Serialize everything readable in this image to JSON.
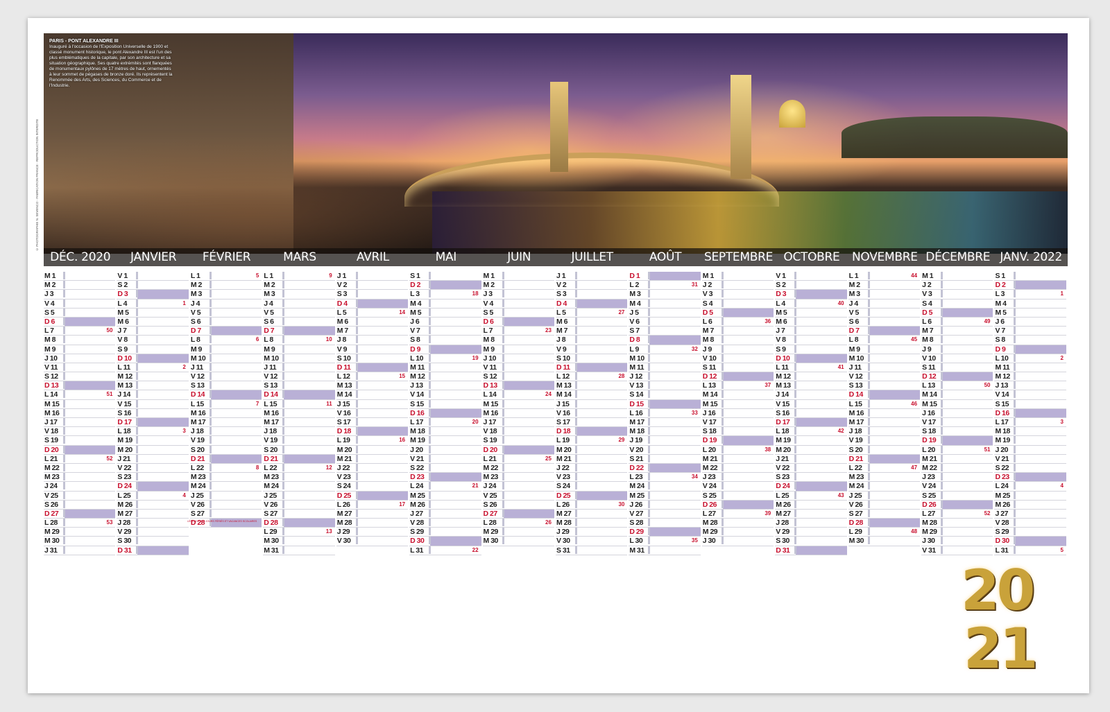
{
  "photo": {
    "caption_title": "PARIS - PONT ALEXANDRE III",
    "caption_text": "Inauguré à l'occasion de l'Exposition Universelle de 1900 et classé monument historique, le pont Alexandre III est l'un des plus emblématiques de la capitale, par son architecture et sa situation géographique. Ses quatre extrémités sont flanquées de monumentaux pylônes de 17 mètres de haut, ornementés à leur sommet de pégases de bronze doré. Ils représentent la Renommée des Arts, des Sciences, du Commerce et de l'Industrie.",
    "copyright": "© PHOTOGRAPHIE N. SEVENCO - FABRICATION FRANCE - REPRODUCTION INTERDITE"
  },
  "months": [
    "DÉC. 2020",
    "JANVIER",
    "FÉVRIER",
    "MARS",
    "AVRIL",
    "MAI",
    "JUIN",
    "JUILLET",
    "AOÛT",
    "SEPTEMBRE",
    "OCTOBRE",
    "NOVEMBRE",
    "DÉCEMBRE",
    "JANV. 2022"
  ],
  "legend": "LÉGENDE DES JOURS FÉRIÉS ET VACANCES SCOLAIRES",
  "year": {
    "line1": "20",
    "line2": "21"
  },
  "colors": {
    "holiday": "#b9b0d6",
    "sunday": "#c8102e",
    "gold": "#c9a23a"
  }
}
